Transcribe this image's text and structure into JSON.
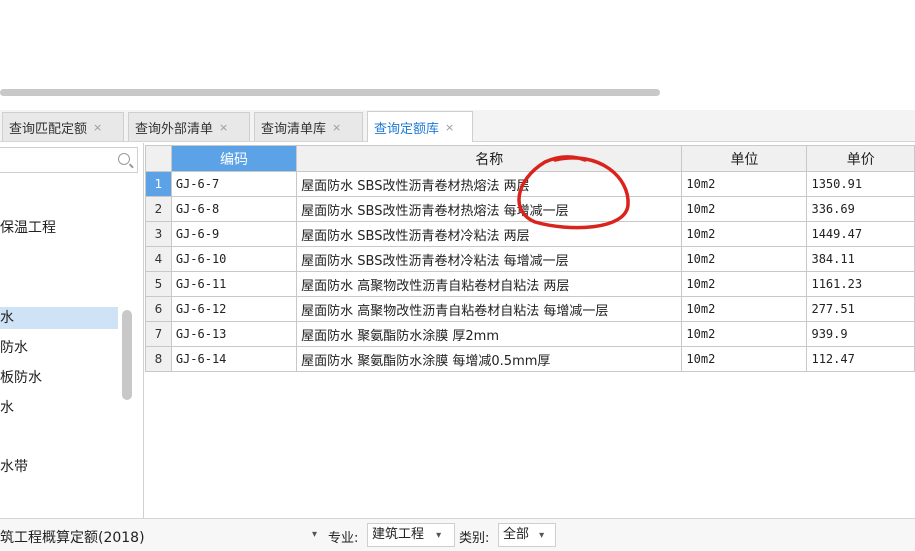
{
  "tabs": [
    {
      "label": "查询匹配定额",
      "close": "×"
    },
    {
      "label": "查询外部清单",
      "close": "×"
    },
    {
      "label": "查询清单库",
      "close": "×"
    },
    {
      "label": "查询定额库",
      "close": "×"
    }
  ],
  "sidebar": {
    "items": [
      "保温工程",
      "水",
      "防水",
      "板防水",
      "水",
      "水带"
    ]
  },
  "grid": {
    "headers": {
      "code": "编码",
      "name": "名称",
      "unit": "单位",
      "price": "单价"
    },
    "rows": [
      {
        "num": "1",
        "code": "GJ-6-7",
        "name": "屋面防水 SBS改性沥青卷材热熔法 两层",
        "unit": "10m2",
        "price": "1350.91"
      },
      {
        "num": "2",
        "code": "GJ-6-8",
        "name": "屋面防水 SBS改性沥青卷材热熔法 每增减一层",
        "unit": "10m2",
        "price": "336.69"
      },
      {
        "num": "3",
        "code": "GJ-6-9",
        "name": "屋面防水 SBS改性沥青卷材冷粘法 两层",
        "unit": "10m2",
        "price": "1449.47"
      },
      {
        "num": "4",
        "code": "GJ-6-10",
        "name": "屋面防水 SBS改性沥青卷材冷粘法 每增减一层",
        "unit": "10m2",
        "price": "384.11"
      },
      {
        "num": "5",
        "code": "GJ-6-11",
        "name": "屋面防水 高聚物改性沥青自粘卷材自粘法 两层",
        "unit": "10m2",
        "price": "1161.23"
      },
      {
        "num": "6",
        "code": "GJ-6-12",
        "name": "屋面防水 高聚物改性沥青自粘卷材自粘法 每增减一层",
        "unit": "10m2",
        "price": "277.51"
      },
      {
        "num": "7",
        "code": "GJ-6-13",
        "name": "屋面防水 聚氨酯防水涂膜 厚2mm",
        "unit": "10m2",
        "price": "939.9"
      },
      {
        "num": "8",
        "code": "GJ-6-14",
        "name": "屋面防水 聚氨酯防水涂膜 每增减0.5mm厚",
        "unit": "10m2",
        "price": "112.47"
      }
    ]
  },
  "bottom": {
    "library": "筑工程概算定额(2018)",
    "specialty_label": "专业:",
    "specialty_value": "建筑工程",
    "category_label": "类别:",
    "category_value": "全部"
  },
  "colors": {
    "accent": "#5ba3e6",
    "active_tab_text": "#1e7bd6",
    "annotation": "#d9231c"
  }
}
